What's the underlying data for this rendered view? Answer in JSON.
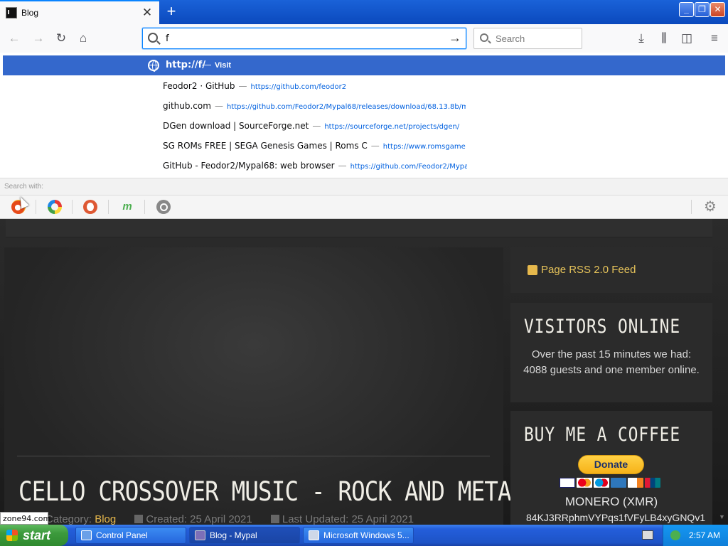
{
  "browser": {
    "tab": {
      "title": "Blog"
    },
    "new_tab_symbol": "+",
    "window_buttons": {
      "minimize": "_",
      "maximize": "❐",
      "close": "✕"
    },
    "url_input_value": "f",
    "search_placeholder": "Search"
  },
  "autocomplete": {
    "visit_row": {
      "url": "http://f/",
      "dash": "—",
      "action": "Visit"
    },
    "suggestions": [
      {
        "title": "Feodor2 · GitHub",
        "url": "https://github.com/feodor2"
      },
      {
        "title": "github.com",
        "url": "https://github.com/Feodor2/Mypal68/releases/download/68.13.8b/m"
      },
      {
        "title": "DGen download | SourceForge.net",
        "url": "https://sourceforge.net/projects/dgen/"
      },
      {
        "title": "SG ROMs FREE | SEGA Genesis Games | Roms C",
        "url": "https://www.romsgame"
      },
      {
        "title": "GitHub - Feodor2/Mypal68: web browser",
        "url": "https://github.com/Feodor2/Mypa"
      }
    ],
    "search_with_label": "Search with:"
  },
  "page": {
    "article_title": "CELLO CROSSOVER MUSIC - ROCK AND METAL",
    "meta": {
      "category_label": "Category:",
      "category_value": "Blog",
      "created": "Created: 25 April 2021",
      "updated": "Last Updated: 25 April 2021"
    },
    "rss_link": "Page RSS 2.0 Feed",
    "visitors": {
      "heading": "VISITORS ONLINE",
      "text": "Over the past 15 minutes we had: 4088 guests and one member online."
    },
    "coffee": {
      "heading": "BUY ME A COFFEE",
      "donate_label": "Donate",
      "monero_label": "MONERO (XMR)",
      "monero_address": "84KJ3RRphmVYPqs1fVFyLB4xyGNQv1"
    },
    "accent_color": "#e6b84c"
  },
  "status_tooltip": "zone94.com",
  "taskbar": {
    "start_label": "start",
    "tasks": [
      {
        "label": "Control Panel"
      },
      {
        "label": "Blog - Mypal"
      },
      {
        "label": "Microsoft Windows 5..."
      }
    ],
    "clock": "2:57 AM"
  }
}
